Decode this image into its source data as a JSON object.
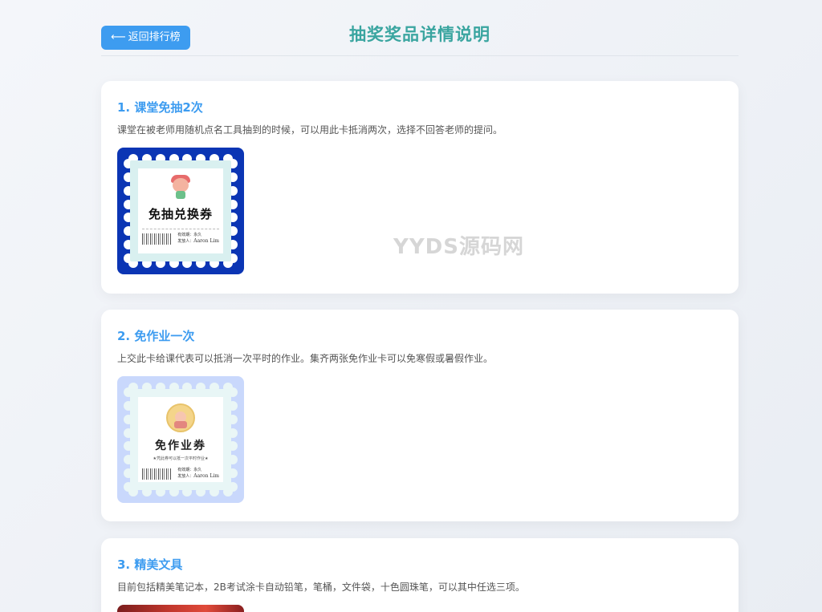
{
  "header": {
    "back_label": "返回排行榜",
    "back_arrow": "⟵",
    "title": "抽奖奖品详情说明"
  },
  "watermark": "YYDS源码网",
  "prizes": [
    {
      "title": "1. 课堂免抽2次",
      "desc": "课堂在被老师用随机点名工具抽到的时候，可以用此卡抵消两次，选择不回答老师的提问。",
      "voucher": {
        "title": "免抽兑换券",
        "date_label": "有效期：永久",
        "issuer_label": "发放人：",
        "issuer_name": "Aaron Lim"
      }
    },
    {
      "title": "2. 免作业一次",
      "desc": "上交此卡给课代表可以抵消一次平时的作业。集齐两张免作业卡可以免寒假或暑假作业。",
      "voucher": {
        "title": "免作业券",
        "subtitle": "★凭此券可以抵一次平时作业★",
        "date_label": "有效期：永久",
        "issuer_label": "发放人：",
        "issuer_name": "Aaron Lim"
      }
    },
    {
      "title": "3. 精美文具",
      "desc": "目前包括精美笔记本，2B考试涂卡自动铅笔，笔桶，文件袋，十色圆珠笔，可以其中任选三项。"
    }
  ],
  "colors": {
    "accent": "#3d9cf0",
    "title": "#3aa5a0",
    "voucher1_border": "#0b35b4",
    "voucher2_border": "#c9d8fc"
  }
}
